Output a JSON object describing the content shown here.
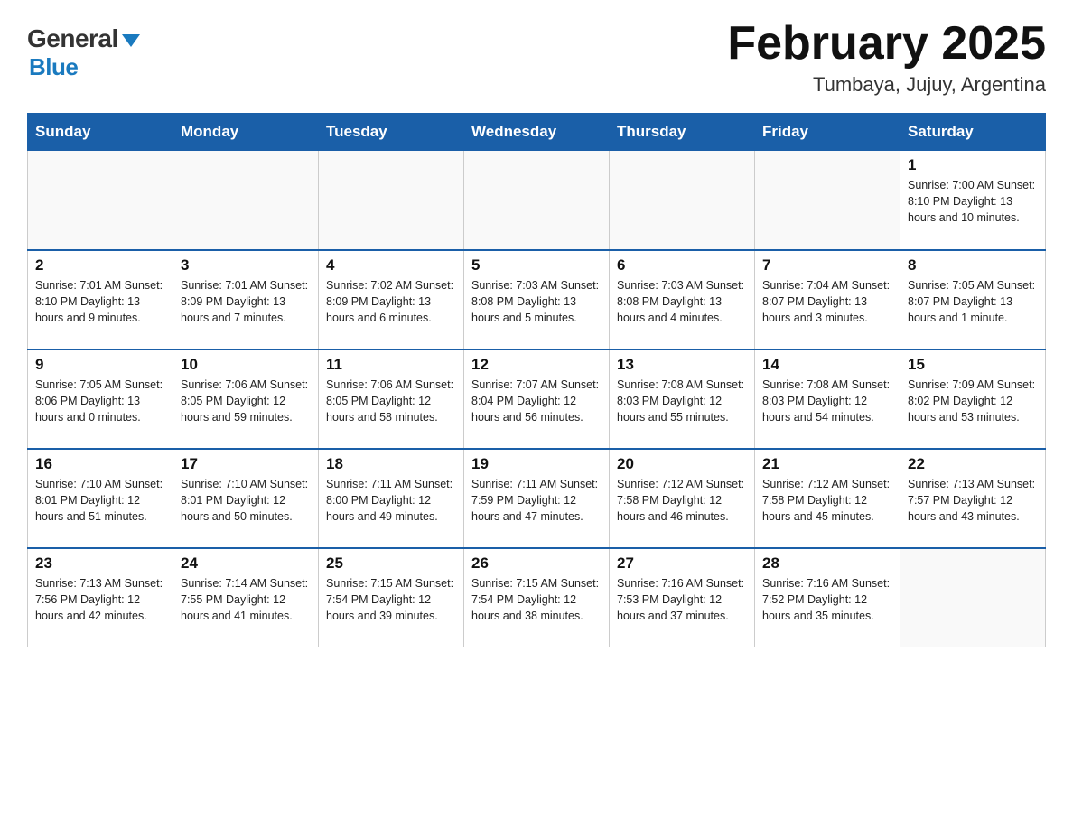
{
  "header": {
    "logo_general": "General",
    "logo_blue": "Blue",
    "month_year": "February 2025",
    "location": "Tumbaya, Jujuy, Argentina"
  },
  "days_of_week": [
    "Sunday",
    "Monday",
    "Tuesday",
    "Wednesday",
    "Thursday",
    "Friday",
    "Saturday"
  ],
  "weeks": [
    [
      {
        "day": "",
        "info": ""
      },
      {
        "day": "",
        "info": ""
      },
      {
        "day": "",
        "info": ""
      },
      {
        "day": "",
        "info": ""
      },
      {
        "day": "",
        "info": ""
      },
      {
        "day": "",
        "info": ""
      },
      {
        "day": "1",
        "info": "Sunrise: 7:00 AM\nSunset: 8:10 PM\nDaylight: 13 hours\nand 10 minutes."
      }
    ],
    [
      {
        "day": "2",
        "info": "Sunrise: 7:01 AM\nSunset: 8:10 PM\nDaylight: 13 hours\nand 9 minutes."
      },
      {
        "day": "3",
        "info": "Sunrise: 7:01 AM\nSunset: 8:09 PM\nDaylight: 13 hours\nand 7 minutes."
      },
      {
        "day": "4",
        "info": "Sunrise: 7:02 AM\nSunset: 8:09 PM\nDaylight: 13 hours\nand 6 minutes."
      },
      {
        "day": "5",
        "info": "Sunrise: 7:03 AM\nSunset: 8:08 PM\nDaylight: 13 hours\nand 5 minutes."
      },
      {
        "day": "6",
        "info": "Sunrise: 7:03 AM\nSunset: 8:08 PM\nDaylight: 13 hours\nand 4 minutes."
      },
      {
        "day": "7",
        "info": "Sunrise: 7:04 AM\nSunset: 8:07 PM\nDaylight: 13 hours\nand 3 minutes."
      },
      {
        "day": "8",
        "info": "Sunrise: 7:05 AM\nSunset: 8:07 PM\nDaylight: 13 hours\nand 1 minute."
      }
    ],
    [
      {
        "day": "9",
        "info": "Sunrise: 7:05 AM\nSunset: 8:06 PM\nDaylight: 13 hours\nand 0 minutes."
      },
      {
        "day": "10",
        "info": "Sunrise: 7:06 AM\nSunset: 8:05 PM\nDaylight: 12 hours\nand 59 minutes."
      },
      {
        "day": "11",
        "info": "Sunrise: 7:06 AM\nSunset: 8:05 PM\nDaylight: 12 hours\nand 58 minutes."
      },
      {
        "day": "12",
        "info": "Sunrise: 7:07 AM\nSunset: 8:04 PM\nDaylight: 12 hours\nand 56 minutes."
      },
      {
        "day": "13",
        "info": "Sunrise: 7:08 AM\nSunset: 8:03 PM\nDaylight: 12 hours\nand 55 minutes."
      },
      {
        "day": "14",
        "info": "Sunrise: 7:08 AM\nSunset: 8:03 PM\nDaylight: 12 hours\nand 54 minutes."
      },
      {
        "day": "15",
        "info": "Sunrise: 7:09 AM\nSunset: 8:02 PM\nDaylight: 12 hours\nand 53 minutes."
      }
    ],
    [
      {
        "day": "16",
        "info": "Sunrise: 7:10 AM\nSunset: 8:01 PM\nDaylight: 12 hours\nand 51 minutes."
      },
      {
        "day": "17",
        "info": "Sunrise: 7:10 AM\nSunset: 8:01 PM\nDaylight: 12 hours\nand 50 minutes."
      },
      {
        "day": "18",
        "info": "Sunrise: 7:11 AM\nSunset: 8:00 PM\nDaylight: 12 hours\nand 49 minutes."
      },
      {
        "day": "19",
        "info": "Sunrise: 7:11 AM\nSunset: 7:59 PM\nDaylight: 12 hours\nand 47 minutes."
      },
      {
        "day": "20",
        "info": "Sunrise: 7:12 AM\nSunset: 7:58 PM\nDaylight: 12 hours\nand 46 minutes."
      },
      {
        "day": "21",
        "info": "Sunrise: 7:12 AM\nSunset: 7:58 PM\nDaylight: 12 hours\nand 45 minutes."
      },
      {
        "day": "22",
        "info": "Sunrise: 7:13 AM\nSunset: 7:57 PM\nDaylight: 12 hours\nand 43 minutes."
      }
    ],
    [
      {
        "day": "23",
        "info": "Sunrise: 7:13 AM\nSunset: 7:56 PM\nDaylight: 12 hours\nand 42 minutes."
      },
      {
        "day": "24",
        "info": "Sunrise: 7:14 AM\nSunset: 7:55 PM\nDaylight: 12 hours\nand 41 minutes."
      },
      {
        "day": "25",
        "info": "Sunrise: 7:15 AM\nSunset: 7:54 PM\nDaylight: 12 hours\nand 39 minutes."
      },
      {
        "day": "26",
        "info": "Sunrise: 7:15 AM\nSunset: 7:54 PM\nDaylight: 12 hours\nand 38 minutes."
      },
      {
        "day": "27",
        "info": "Sunrise: 7:16 AM\nSunset: 7:53 PM\nDaylight: 12 hours\nand 37 minutes."
      },
      {
        "day": "28",
        "info": "Sunrise: 7:16 AM\nSunset: 7:52 PM\nDaylight: 12 hours\nand 35 minutes."
      },
      {
        "day": "",
        "info": ""
      }
    ]
  ]
}
